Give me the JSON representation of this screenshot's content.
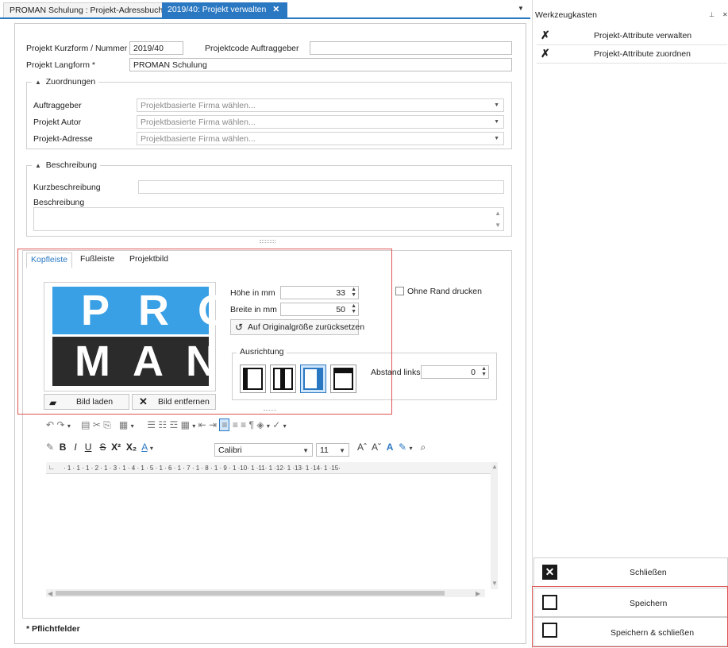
{
  "tabs": {
    "inactive": "PROMAN Schulung : Projekt-Adressbuch",
    "active": "2019/40: Projekt verwalten",
    "close": "✕"
  },
  "form": {
    "kurzform_label": "Projekt Kurzform / Nummer *",
    "kurzform_value": "2019/40",
    "projektcode_label": "Projektcode Auftraggeber",
    "projektcode_value": "",
    "langform_label": "Projekt Langform *",
    "langform_value": "PROMAN Schulung"
  },
  "zuordnungen": {
    "title": "Zuordnungen",
    "rows": [
      {
        "label": "Auftraggeber",
        "placeholder": "Projektbasierte Firma wählen..."
      },
      {
        "label": "Projekt Autor",
        "placeholder": "Projektbasierte Firma wählen..."
      },
      {
        "label": "Projekt-Adresse",
        "placeholder": "Projektbasierte Firma wählen..."
      }
    ]
  },
  "beschreibung": {
    "title": "Beschreibung",
    "kurz_label": "Kurzbeschreibung",
    "kurz_value": "",
    "lang_label": "Beschreibung"
  },
  "innertabs": [
    "Kopfleiste",
    "Fußleiste",
    "Projektbild"
  ],
  "logo": {
    "line1": "PRO",
    "line2": "MAN",
    "blue": "#3aa0e6",
    "dark": "#2b2b2b"
  },
  "image_buttons": {
    "laden": "Bild laden",
    "entfernen": "Bild entfernen"
  },
  "size": {
    "hoehe_label": "Höhe in mm",
    "hoehe_value": "33",
    "breite_label": "Breite in mm",
    "breite_value": "50",
    "reset_label": "Auf Originalgröße zurücksetzen",
    "ohne_rand_label": "Ohne Rand drucken"
  },
  "ausrichtung": {
    "title": "Ausrichtung",
    "abstand_label": "Abstand links",
    "abstand_value": "0"
  },
  "editor": {
    "font": "Calibri",
    "size": "11",
    "ruler": "· 1 · 1 · 1 · 2 · 1 · 3 · 1 · 4 · 1 · 5 · 1 · 6 · 1 · 7 · 1 · 8 · 1 · 9 · 1 ·10· 1 ·11· 1 ·12· 1 ·13· 1 ·14· 1 ·15·"
  },
  "footer": {
    "pflicht": "* Pflichtfelder"
  },
  "ribbon": {
    "title": "Werkzeugkasten",
    "tools": [
      "Projekt-Attribute verwalten",
      "Projekt-Attribute zuordnen"
    ],
    "bottom": [
      "Schließen",
      "Speichern",
      "Speichern & schließen"
    ]
  },
  "colors": {
    "accent": "#2b78c2",
    "highlight_border": "#e05555"
  }
}
